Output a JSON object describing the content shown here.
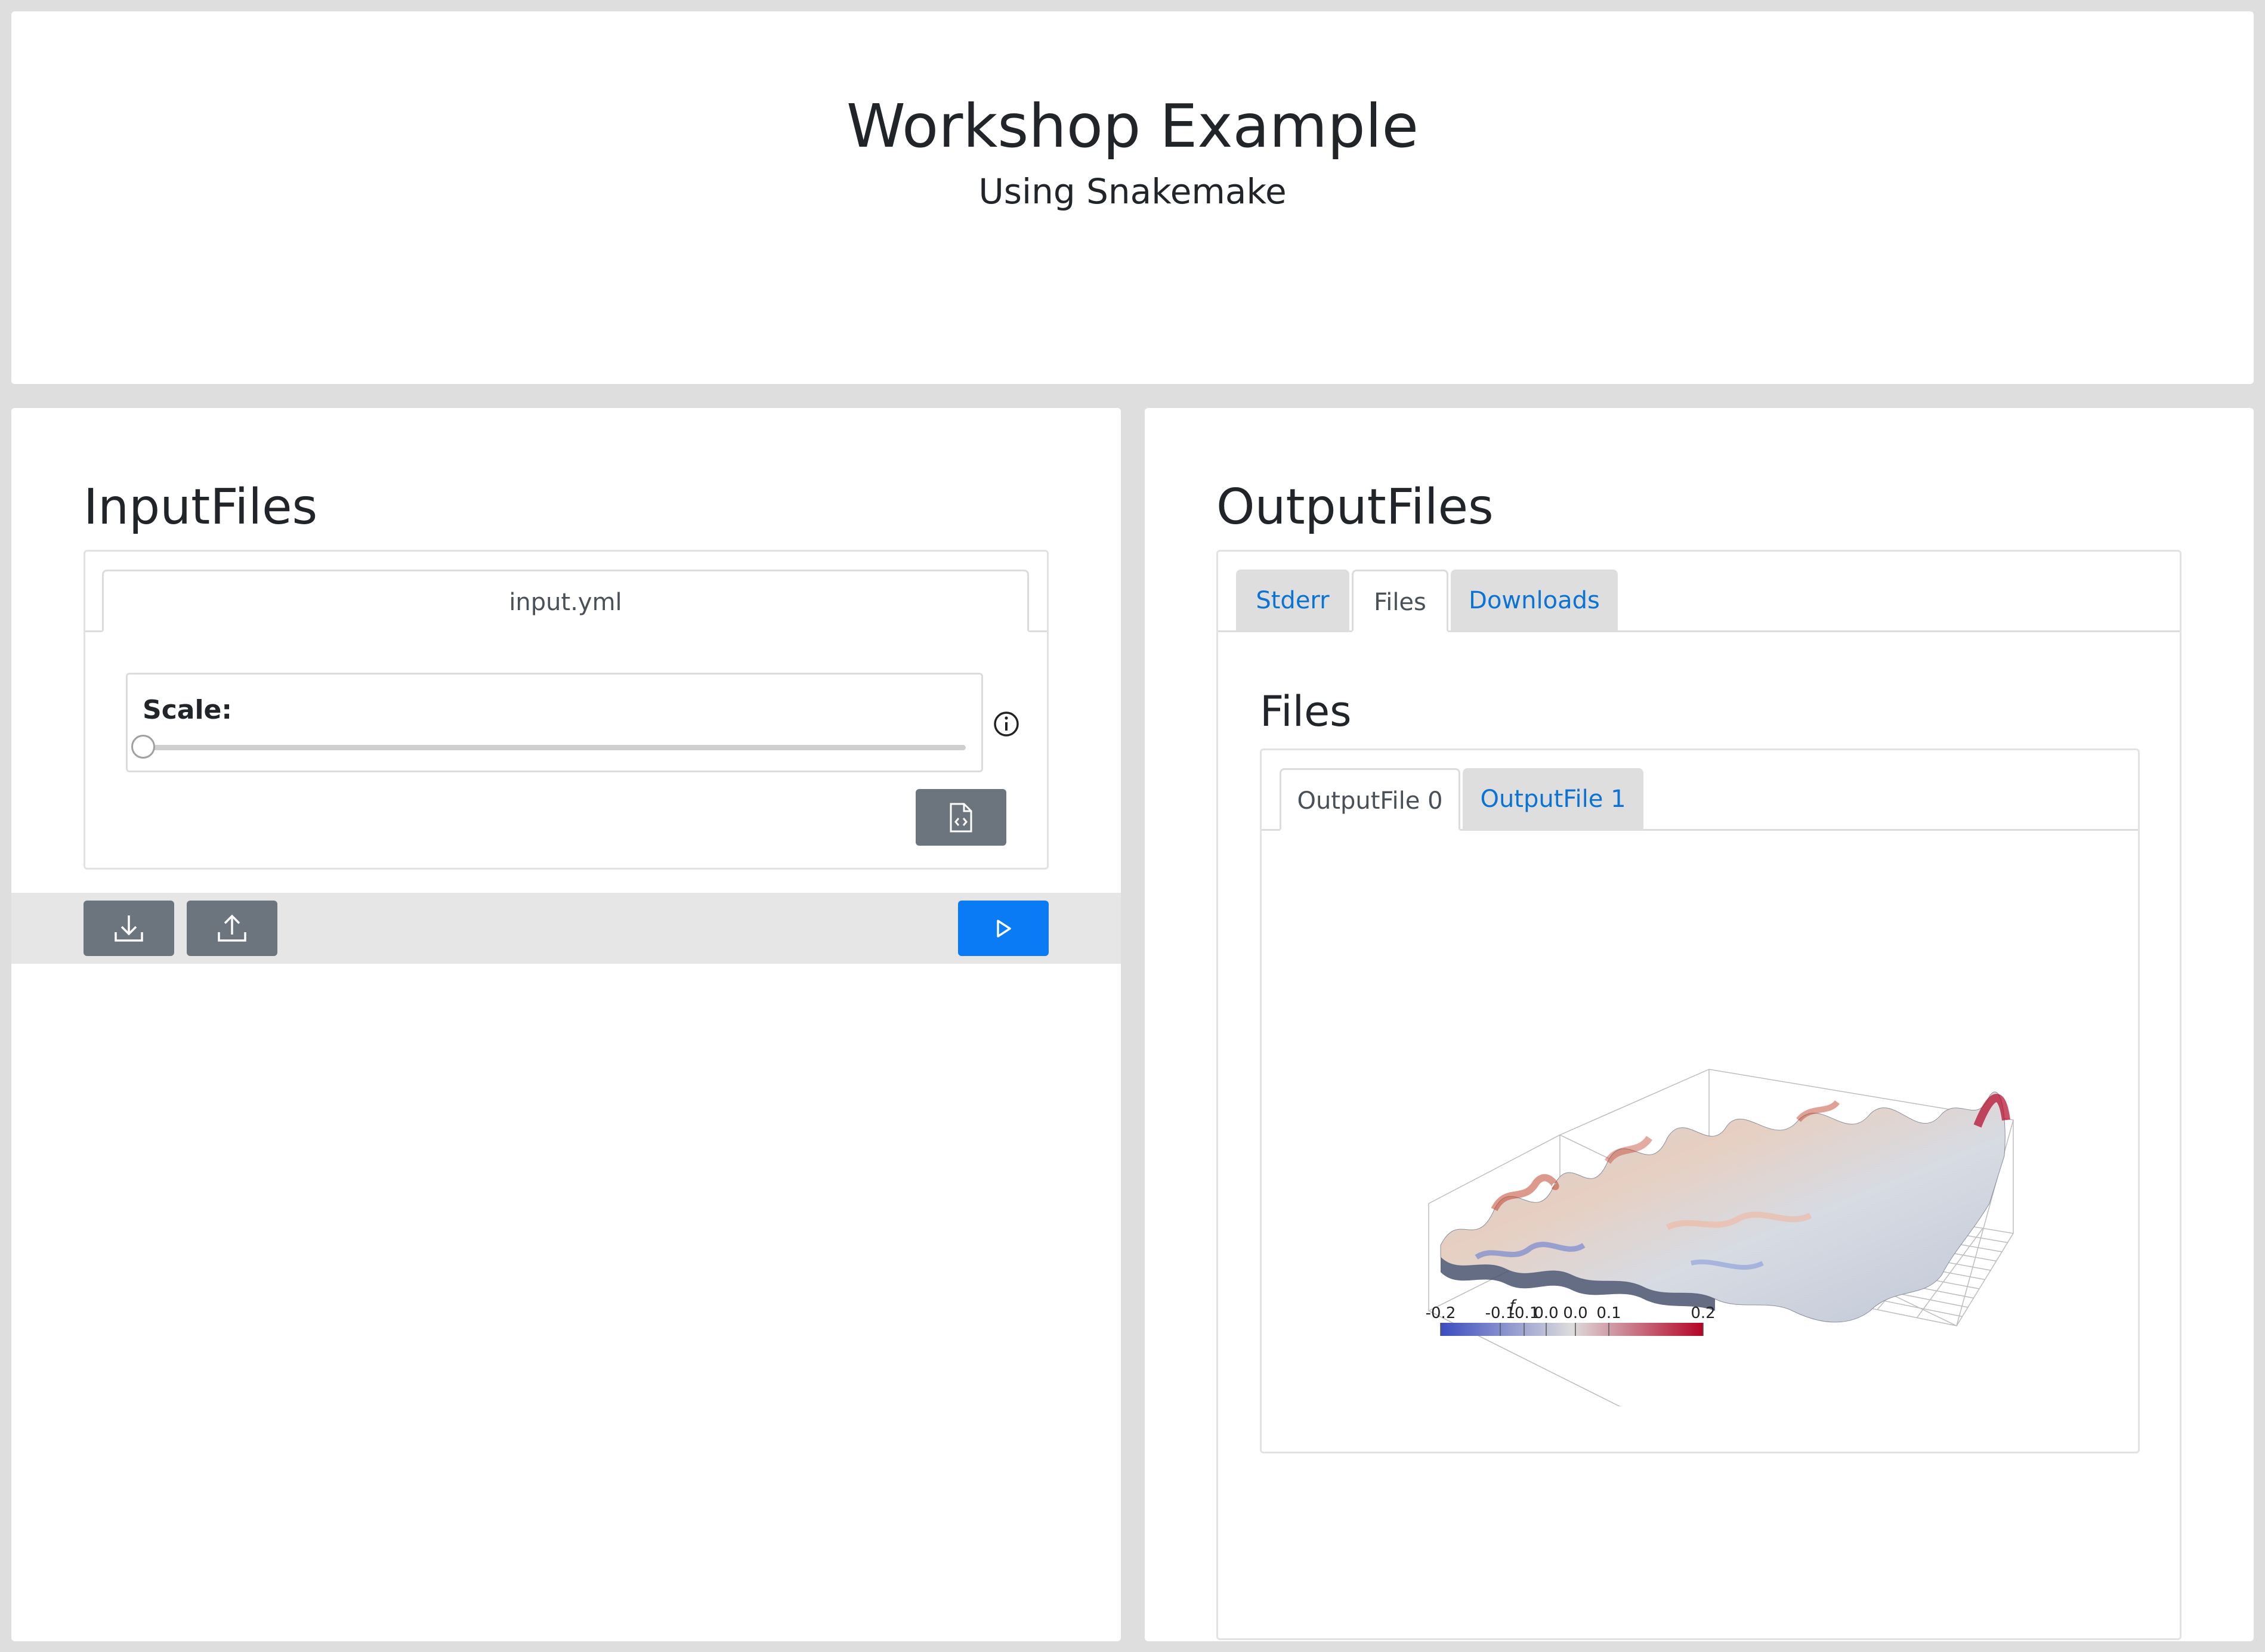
{
  "header": {
    "title": "Workshop Example",
    "subtitle": "Using Snakemake"
  },
  "input_panel": {
    "heading": "InputFiles",
    "tab": "input.yml",
    "slider": {
      "label": "Scale:",
      "value_fraction": 0.0
    }
  },
  "output_panel": {
    "heading": "OutputFiles",
    "tabs": [
      {
        "label": "Stderr",
        "active": false
      },
      {
        "label": "Files",
        "active": true
      },
      {
        "label": "Downloads",
        "active": false
      }
    ],
    "files_heading": "Files",
    "file_tabs": [
      {
        "label": "OutputFile 0",
        "active": true
      },
      {
        "label": "OutputFile 1",
        "active": false
      }
    ]
  },
  "plot": {
    "colorbar_title": "f",
    "colorbar_ticks": [
      "-0.2",
      "-0.1",
      "-0.1",
      "0.0",
      "0.0",
      "0.1",
      "0.2"
    ],
    "colors": {
      "low": "#3b4cc0",
      "mid": "#dddcdc",
      "high": "#b40426"
    }
  },
  "colors": {
    "accent": "#0a7bf5",
    "secondary": "#6c757d",
    "link": "#0b72d6"
  }
}
